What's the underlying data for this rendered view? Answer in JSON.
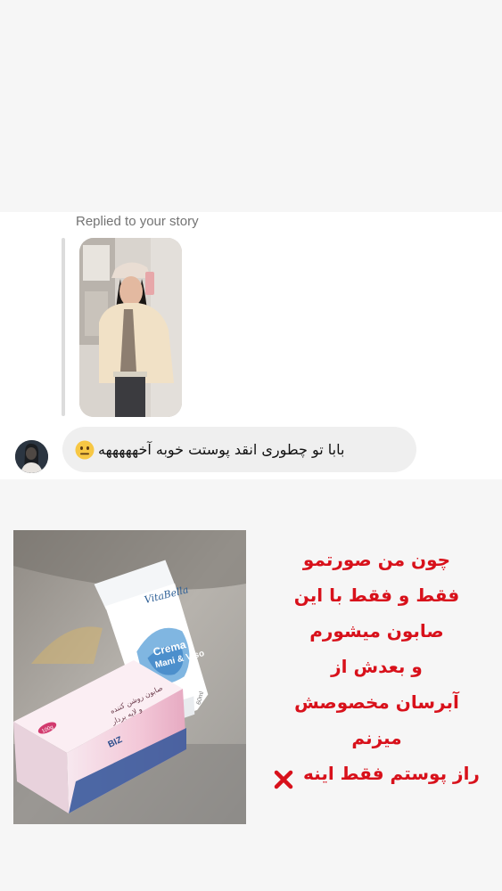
{
  "reply": {
    "label": "Replied to your story"
  },
  "message": {
    "text": "بابا تو چطوری انقد پوستت خوبه آخهههههه",
    "emoji": "neutral-face-icon"
  },
  "caption": {
    "lines": [
      "چون من صورتمو",
      "فقط و فقط با این",
      "صابون میشورم",
      "و بعدش از",
      "آبرسان مخصوصش",
      "میزنم",
      "راز پوستم فقط اینه"
    ],
    "end_mark": "cross-mark-icon"
  },
  "product": {
    "tube_brand": "VitaBella",
    "tube_title_line1": "Crema",
    "tube_title_line2": "Mani & Viso",
    "tube_volume": "60ml",
    "box_text_line1": "صابون روشن کننده",
    "box_text_line2": "و لایه بردار",
    "box_brand": "BIZ",
    "box_badge": "100g"
  },
  "colors": {
    "caption_red": "#d8111b",
    "bubble_bg": "#efefef",
    "reply_label": "#737373"
  }
}
